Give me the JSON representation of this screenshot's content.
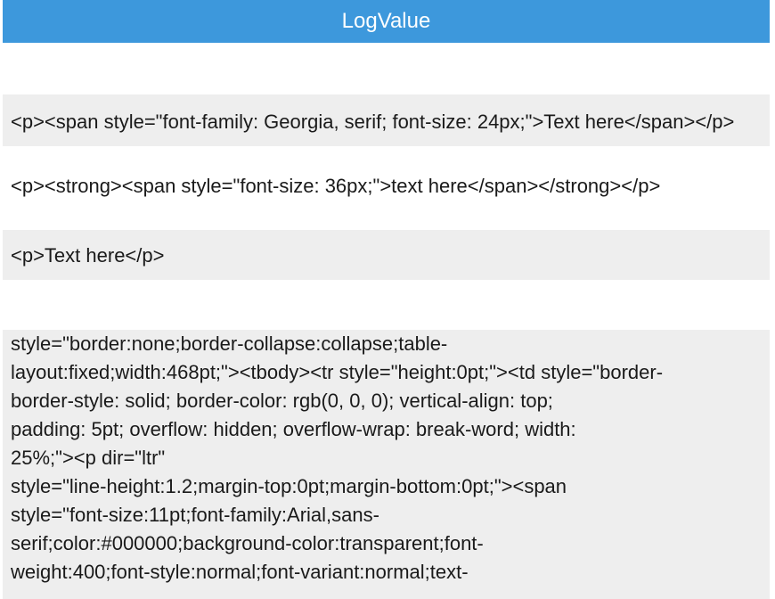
{
  "table": {
    "column_header": "LogValue",
    "rows": [
      "",
      "<p><span style=\"font-family: Georgia, serif; font-size: 24px;\">Text here</span></p>",
      "<p><strong><span style=\"font-size: 36px;\">text here</span></strong></p>",
      "<p>Text here</p>",
      ""
    ],
    "long_row_lines": [
      "style=\"border:none;border-collapse:collapse;table-",
      "layout:fixed;width:468pt;\"><tbody><tr style=\"height:0pt;\"><td style=\"border-",
      "border-style: solid; border-color: rgb(0, 0, 0); vertical-align: top;",
      "padding: 5pt; overflow: hidden; overflow-wrap: break-word; width:",
      "25%;\"><p dir=\"ltr\"",
      "style=\"line-height:1.2;margin-top:0pt;margin-bottom:0pt;\"><span",
      "style=\"font-size:11pt;font-family:Arial,sans-",
      "serif;color:#000000;background-color:transparent;font-",
      "weight:400;font-style:normal;font-variant:normal;text-"
    ]
  },
  "colors": {
    "header_bg": "#3d98dc",
    "header_text": "#ffffff",
    "row_alt_bg": "#eeeeee",
    "row_bg": "#ffffff",
    "text": "#1a1a1a"
  }
}
